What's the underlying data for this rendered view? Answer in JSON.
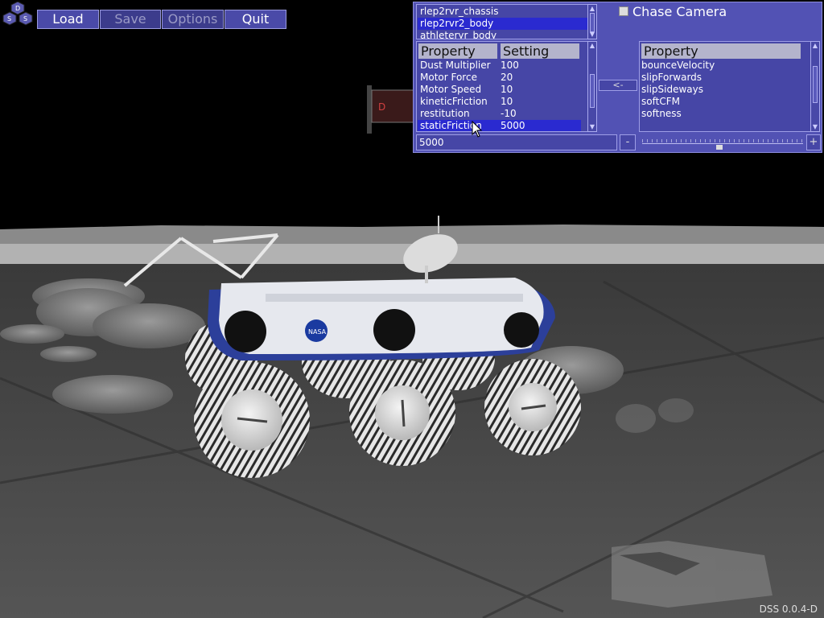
{
  "toolbar": {
    "load": "Load",
    "save": "Save",
    "options": "Options",
    "quit": "Quit",
    "logo_letters": [
      "D",
      "S",
      "S"
    ]
  },
  "panel": {
    "objects": [
      "rlep2rvr_chassis",
      "rlep2rvr2_body",
      "athleteryr_body"
    ],
    "selected_object_index": 1,
    "chase_camera_label": "Chase Camera",
    "chase_camera_checked": false,
    "property_header": "Property",
    "setting_header": "Setting",
    "properties": [
      {
        "name": "Dust Multiplier",
        "value": "100"
      },
      {
        "name": "Motor Force",
        "value": "20"
      },
      {
        "name": "Motor Speed",
        "value": "10"
      },
      {
        "name": "kineticFriction",
        "value": "10"
      },
      {
        "name": "restitution",
        "value": "-10"
      },
      {
        "name": "staticFriction",
        "value": "5000"
      }
    ],
    "selected_property_index": 5,
    "value_input": "5000",
    "move_button": "<-",
    "minus_button": "-",
    "plus_button": "+",
    "available_header": "Property",
    "available_properties": [
      "bounceVelocity",
      "slipForwards",
      "slipSideways",
      "softCFM",
      "softness"
    ],
    "slider_level": 0.48
  },
  "version": "DSS 0.0.4-D",
  "colors": {
    "panel": "#5252b4",
    "selection": "#2a2ad0",
    "sky": "#000000",
    "ground": "#4a4a4a"
  }
}
